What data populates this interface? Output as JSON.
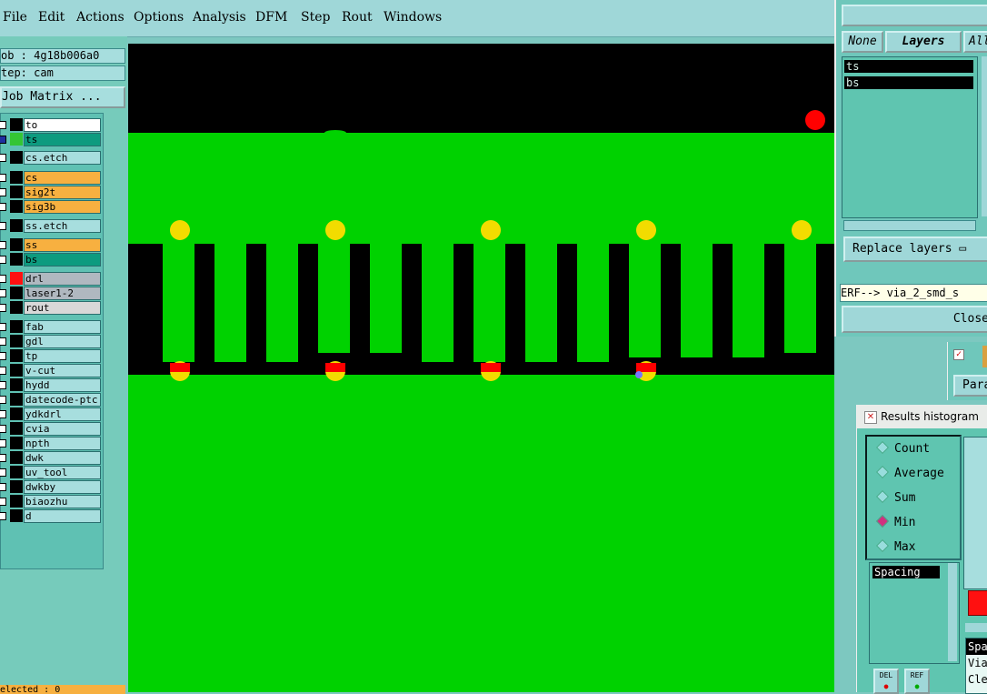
{
  "menu": [
    "File",
    "Edit",
    "Actions",
    "Options",
    "Analysis",
    "DFM",
    "Step",
    "Rout",
    "Windows"
  ],
  "job": {
    "job_line": "ob : 4g18b006a0",
    "step_line": "tep: cam",
    "matrix_button": "Job Matrix ..."
  },
  "layers": [
    {
      "name": "to",
      "bg": "#ffffff",
      "swatch": "#000000"
    },
    {
      "name": "ts",
      "bg": "#0d9b7f",
      "swatch": "#34c534",
      "mark": "⊕",
      "chk": "#1f2fa0"
    },
    {
      "name": "cs.etch",
      "bg": "#a7dede",
      "swatch": "#000000"
    },
    {
      "name": "cs",
      "bg": "#f7b040",
      "swatch": "#000000"
    },
    {
      "name": "sig2t",
      "bg": "#f7b040",
      "swatch": "#000000",
      "mark": "✎"
    },
    {
      "name": "sig3b",
      "bg": "#f7b040",
      "swatch": "#000000"
    },
    {
      "name": "ss.etch",
      "bg": "#a7dede",
      "swatch": "#000000"
    },
    {
      "name": "ss",
      "bg": "#f7b040",
      "swatch": "#000000"
    },
    {
      "name": "bs",
      "bg": "#0d9b7f",
      "swatch": "#000000"
    },
    {
      "name": "drl",
      "bg": "#b0b8c0",
      "swatch": "#ff1010"
    },
    {
      "name": "laser1-2",
      "bg": "#b0b8c0",
      "swatch": "#000000"
    },
    {
      "name": "rout",
      "bg": "#d8d8d8",
      "swatch": "#000000"
    },
    {
      "name": "fab",
      "bg": "#a7dede",
      "swatch": "#000000",
      "mark": "✎"
    },
    {
      "name": "gdl",
      "bg": "#a7dede",
      "swatch": "#000000"
    },
    {
      "name": "tp",
      "bg": "#a7dede",
      "swatch": "#000000"
    },
    {
      "name": "v-cut",
      "bg": "#a7dede",
      "swatch": "#000000"
    },
    {
      "name": "hydd",
      "bg": "#a7dede",
      "swatch": "#000000"
    },
    {
      "name": "datecode-ptc",
      "bg": "#a7dede",
      "swatch": "#000000"
    },
    {
      "name": "ydkdrl",
      "bg": "#a7dede",
      "swatch": "#000000"
    },
    {
      "name": "cvia",
      "bg": "#a7dede",
      "swatch": "#000000"
    },
    {
      "name": "npth",
      "bg": "#a7dede",
      "swatch": "#000000"
    },
    {
      "name": "dwk",
      "bg": "#a7dede",
      "swatch": "#000000"
    },
    {
      "name": "uv_tool",
      "bg": "#a7dede",
      "swatch": "#000000"
    },
    {
      "name": "dwkby",
      "bg": "#a7dede",
      "swatch": "#000000"
    },
    {
      "name": "biaozhu",
      "bg": "#a7dede",
      "swatch": "#000000"
    },
    {
      "name": "d",
      "bg": "#a7dede",
      "swatch": "#000000"
    }
  ],
  "selected_strip": "elected : 0",
  "right_panel": {
    "tab_none": "None",
    "tab_layers": "Layers",
    "tab_all": "All",
    "layer_items": [
      "ts",
      "bs"
    ],
    "replace_layers": "Replace layers",
    "erf_text": "ERF--> via_2_smd_s",
    "close_button": "Close",
    "para_button": "Para"
  },
  "histogram": {
    "title": "Results histogram",
    "options": [
      "Count",
      "Average",
      "Sum",
      "Min",
      "Max"
    ],
    "selected": "Min",
    "list_items": [
      "Spacing"
    ],
    "del_button": "DEL",
    "ref_button": "REF",
    "side_text": [
      "Spa",
      "Via",
      "Cle"
    ]
  },
  "colors": {
    "board_green": "#00d200",
    "background_black": "#000000",
    "pad_yellow": "#f2dc00",
    "marker_red": "#ff0000"
  }
}
